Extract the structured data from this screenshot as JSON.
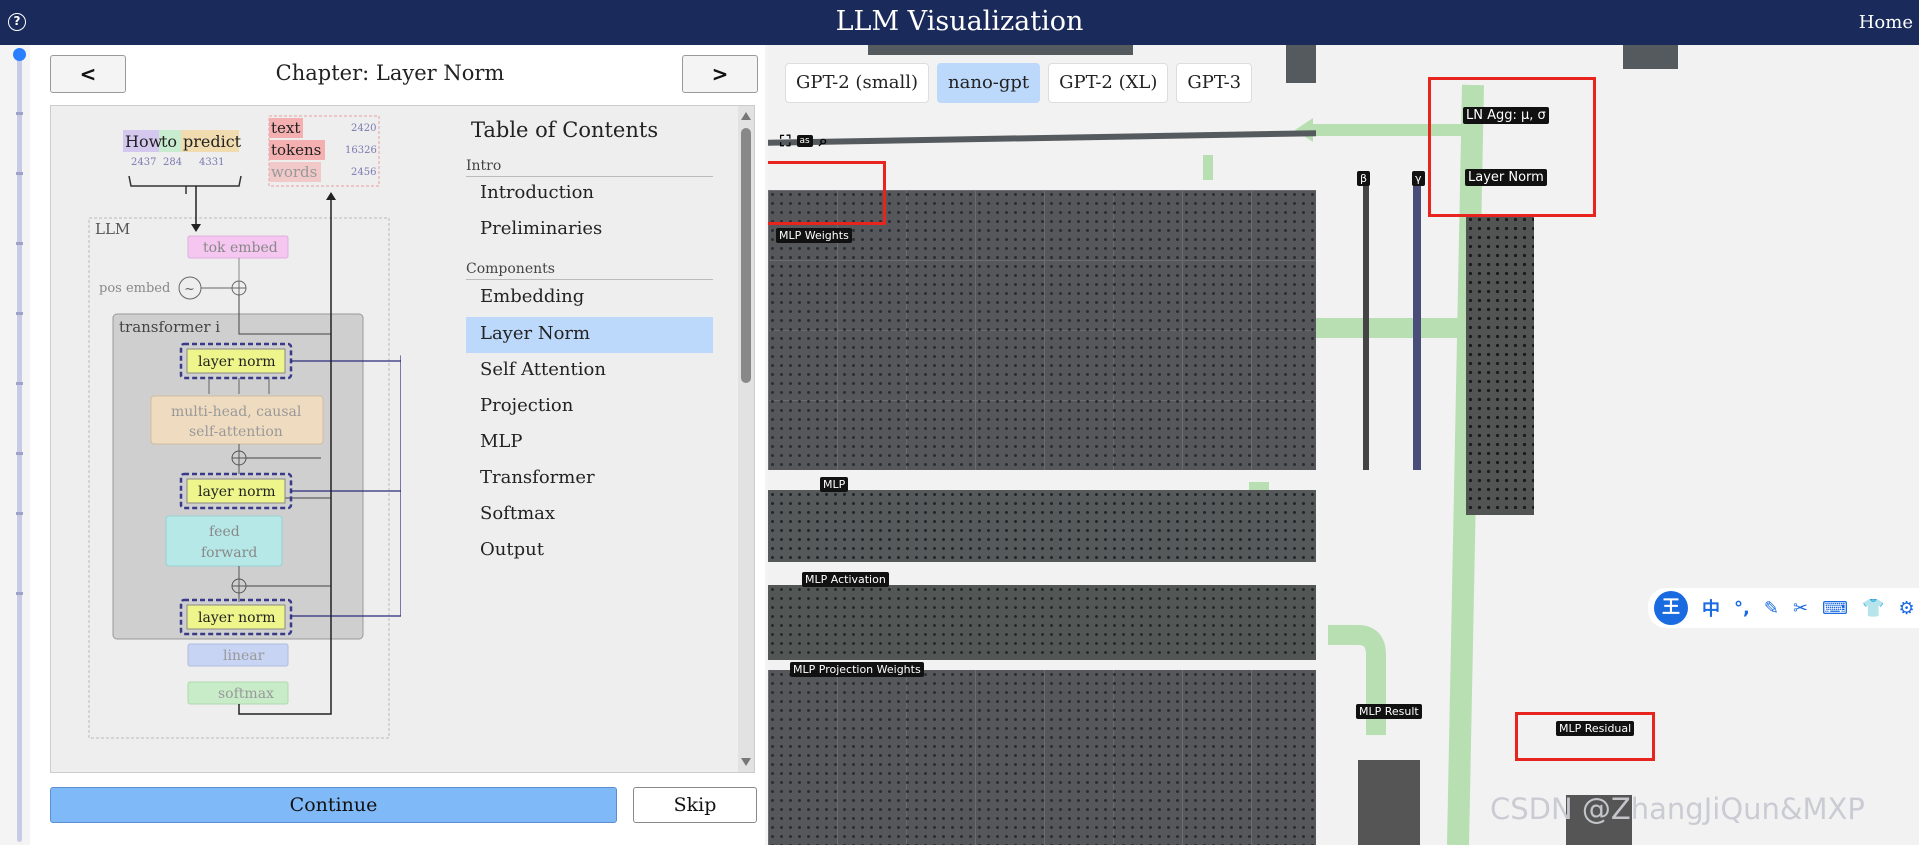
{
  "app": {
    "title": "LLM Visualization",
    "home": "Home",
    "help": "?"
  },
  "left_panel": {
    "chapter_title": "Chapter: Layer Norm",
    "prev": "<",
    "next": ">",
    "tokens": [
      {
        "word": "How",
        "id": "2437"
      },
      {
        "word": "to",
        "id": "284"
      },
      {
        "word": "predict",
        "id": "4331"
      }
    ],
    "vocab": [
      {
        "word": "text",
        "id": "2420"
      },
      {
        "word": "tokens",
        "id": "16326"
      },
      {
        "word": "words",
        "id": "2456"
      }
    ],
    "diagram": {
      "llm": "LLM",
      "tok_embed": "tok embed",
      "pos_embed": "pos embed",
      "transformer": "transformer i",
      "layer_norm": "layer norm",
      "attention_1": "multi-head, causal",
      "attention_2": "self-attention",
      "ff_1": "feed",
      "ff_2": "forward",
      "linear": "linear",
      "softmax": "softmax"
    },
    "toc": {
      "title": "Table of Contents",
      "sections": [
        {
          "name": "Intro",
          "items": [
            "Introduction",
            "Preliminaries"
          ]
        },
        {
          "name": "Components",
          "items": [
            "Embedding",
            "Layer Norm",
            "Self Attention",
            "Projection",
            "MLP",
            "Transformer",
            "Softmax",
            "Output"
          ]
        }
      ],
      "active": "Layer Norm"
    },
    "continue": "Continue",
    "skip": "Skip"
  },
  "viz": {
    "models": [
      "GPT-2 (small)",
      "nano-gpt",
      "GPT-2 (XL)",
      "GPT-3"
    ],
    "selected_model": "nano-gpt",
    "labels": {
      "mlp_weights": "MLP Weights",
      "mlp": "MLP",
      "mlp_activation": "MLP Activation",
      "mlp_proj_weights": "MLP Projection Weights",
      "mlp_result": "MLP Result",
      "mlp_residual": "MLP Residual",
      "ln_agg": "LN Agg: μ, σ",
      "layer_norm": "Layer Norm",
      "beta": "β",
      "gamma": "γ",
      "bias": "as"
    }
  },
  "watermark": "CSDN @ZhangJiQun&MXP",
  "ime": {
    "logo": "王",
    "items": [
      "中",
      "°,",
      "✎",
      "✂",
      "⌨",
      "👕",
      "⚙"
    ]
  },
  "colors": {
    "nav": "#1a2a5a",
    "active": "#bcd8fb",
    "continue": "#7fb9f7",
    "highlight": "#e8241e"
  }
}
